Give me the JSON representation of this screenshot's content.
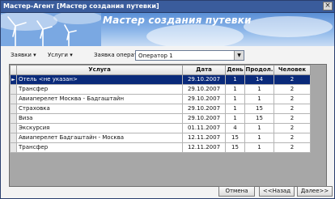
{
  "window": {
    "title": "Мастер-Агент [Мастер создания путевки]",
    "close_glyph": "×"
  },
  "banner": {
    "title": "Мастер создания путевки"
  },
  "toolbar": {
    "menu_requests": "Заявки",
    "menu_services": "Услуги",
    "operator_label": "Заявка оператору",
    "operator_value": "Оператор 1",
    "dropdown_glyph": "▼",
    "menu_arrow_glyph": "▾"
  },
  "table": {
    "columns": [
      "Услуга",
      "Дата",
      "День",
      "Продол.",
      "Человек"
    ],
    "selected_row_marker": "►",
    "rows": [
      {
        "service": "Отель <не указан>",
        "date": "29.10.2007",
        "day": "1",
        "duration": "14",
        "people": "2",
        "selected": true
      },
      {
        "service": "Трансфер",
        "date": "29.10.2007",
        "day": "1",
        "duration": "1",
        "people": "2"
      },
      {
        "service": "Авиаперелет Москва - Бадгаштайн",
        "date": "29.10.2007",
        "day": "1",
        "duration": "1",
        "people": "2"
      },
      {
        "service": "Страховка",
        "date": "29.10.2007",
        "day": "1",
        "duration": "15",
        "people": "2"
      },
      {
        "service": "Виза",
        "date": "29.10.2007",
        "day": "1",
        "duration": "15",
        "people": "2"
      },
      {
        "service": "Экскурсия",
        "date": "01.11.2007",
        "day": "4",
        "duration": "1",
        "people": "2"
      },
      {
        "service": "Авиаперелет Бадгаштайн - Москва",
        "date": "12.11.2007",
        "day": "15",
        "duration": "1",
        "people": "2"
      },
      {
        "service": "Трансфер",
        "date": "12.11.2007",
        "day": "15",
        "duration": "1",
        "people": "2"
      }
    ]
  },
  "buttons": {
    "cancel": "Отмена",
    "back": "<<Назад",
    "next": "Далее>>"
  },
  "colors": {
    "title_bar": "#3a5c9c",
    "selected_row": "#0a2a7a",
    "banner_sky": "#8fb8ea"
  }
}
